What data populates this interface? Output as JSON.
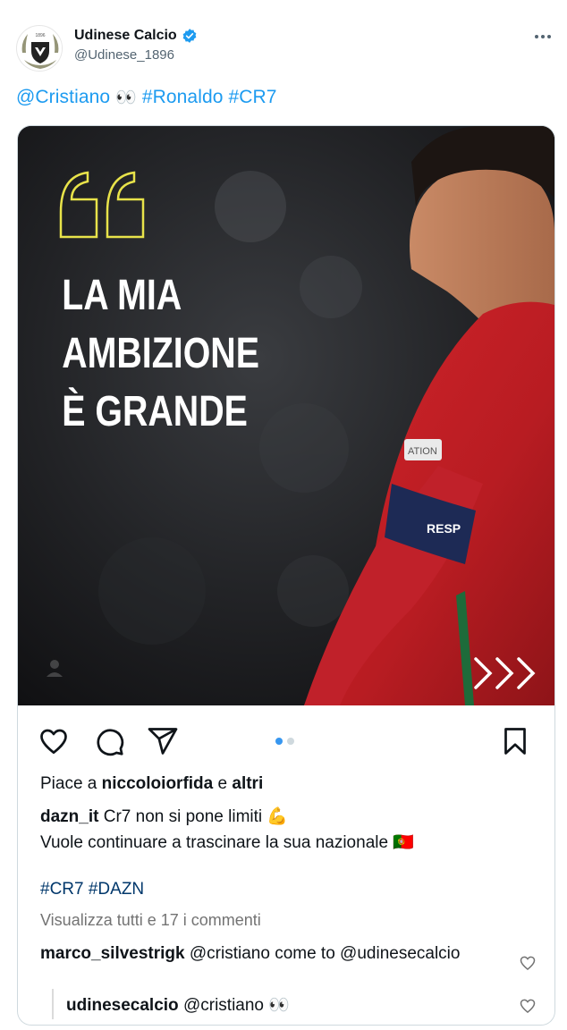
{
  "tweet": {
    "author_name": "Udinese Calcio",
    "author_handle": "@Udinese_1896",
    "text_mention": "@Cristiano",
    "text_eyes": "👀",
    "text_hashtags": "#Ronaldo #CR7",
    "logo_year": "1896"
  },
  "colors": {
    "link_blue": "#1d9bf0",
    "verified_blue": "#1d9bf0",
    "instagram_dot_active": "#3797f0",
    "quote_yellow": "#e8e34a"
  },
  "post": {
    "image_headline": [
      "LA MIA",
      "AMBIZIONE",
      "È GRANDE"
    ],
    "jersey_patch": "ATION",
    "armband_text": "RESP",
    "carousel_dots": 2,
    "carousel_active": 0,
    "likes_prefix": "Piace a",
    "likes_user": "niccoloiorfida",
    "likes_and": "e",
    "likes_others": "altri",
    "caption_user": "dazn_it",
    "caption_text": "Cr7 non si pone limiti 💪",
    "caption_line2": "Vuole continuare a trascinare la sua nazionale 🇵🇹",
    "hashtags": "#CR7 #DAZN",
    "view_comments": "Visualizza tutti e 17 i commenti",
    "comments": [
      {
        "user": "marco_silvestrigk",
        "text": "@cristiano come to @udinesecalcio"
      },
      {
        "user": "udinesecalcio",
        "text": "@cristiano 👀"
      }
    ]
  },
  "icons": [
    "udinese-logo-icon",
    "verified-badge-icon",
    "more-options-icon",
    "heart-icon",
    "comment-icon",
    "share-icon",
    "bookmark-icon",
    "quote-icon",
    "next-arrows-icon",
    "small-heart-icon"
  ]
}
